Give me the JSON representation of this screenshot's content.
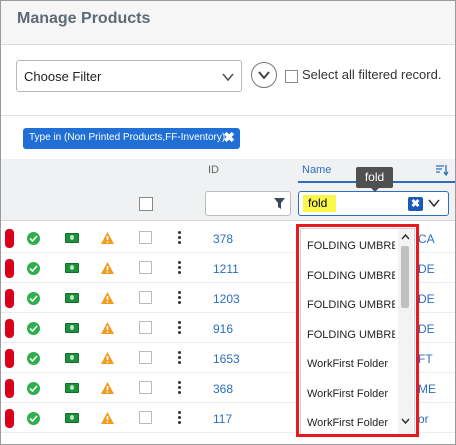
{
  "page": {
    "title": "Manage Products"
  },
  "filter_bar": {
    "filter_select_value": "Choose Filter",
    "select_all_label": "Select all filtered record."
  },
  "active_filter_chip": {
    "label": "Type in (Non Printed Products,FF-Inventory)",
    "remove_glyph": "✖"
  },
  "table": {
    "columns": {
      "id": "ID",
      "name": "Name"
    },
    "name_filter_value": "fold",
    "tooltip": "fold",
    "clear_glyph": "✖",
    "rows": [
      {
        "id": "378",
        "name_fragment": "CA"
      },
      {
        "id": "1211",
        "name_fragment": "DE"
      },
      {
        "id": "1203",
        "name_fragment": "DE"
      },
      {
        "id": "916",
        "name_fragment": "DE"
      },
      {
        "id": "1653",
        "name_fragment": "FT"
      },
      {
        "id": "368",
        "name_fragment": "ME"
      },
      {
        "id": "117",
        "name_fragment": "or"
      }
    ]
  },
  "name_dropdown": {
    "items": [
      "FOLDING UMBRELLA",
      "FOLDING UMBRELLA",
      "FOLDING UMBRELLA",
      "FOLDING UMBRELLA",
      "WorkFirst Folder",
      "WorkFirst Folder",
      "WorkFirst Folder"
    ]
  },
  "colors": {
    "accent": "#1f6fd6",
    "status_red": "#d9001b",
    "ok_green": "#2eae4c",
    "money_green": "#1e8f3c",
    "warning_orange": "#f29b1f",
    "highlight": "#fbf74a",
    "annotation_red": "#e8191f"
  },
  "icons": {
    "status": "status-flag-icon",
    "ok": "check-circle-icon",
    "money": "money-icon",
    "warning": "warning-triangle-icon",
    "menu": "kebab-menu-icon",
    "filter": "funnel-icon",
    "sort": "sort-icon"
  }
}
